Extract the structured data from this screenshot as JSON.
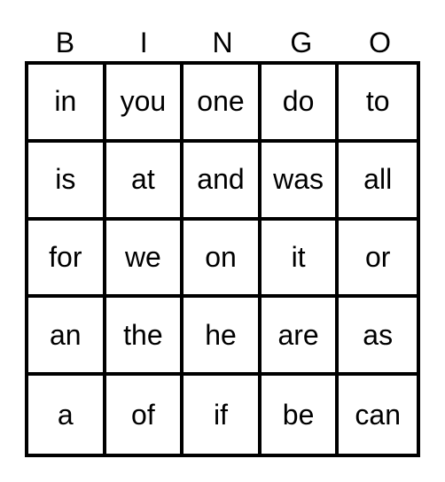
{
  "header": [
    "B",
    "I",
    "N",
    "G",
    "O"
  ],
  "cells": [
    [
      "in",
      "you",
      "one",
      "do",
      "to"
    ],
    [
      "is",
      "at",
      "and",
      "was",
      "all"
    ],
    [
      "for",
      "we",
      "on",
      "it",
      "or"
    ],
    [
      "an",
      "the",
      "he",
      "are",
      "as"
    ],
    [
      "a",
      "of",
      "if",
      "be",
      "can"
    ]
  ]
}
